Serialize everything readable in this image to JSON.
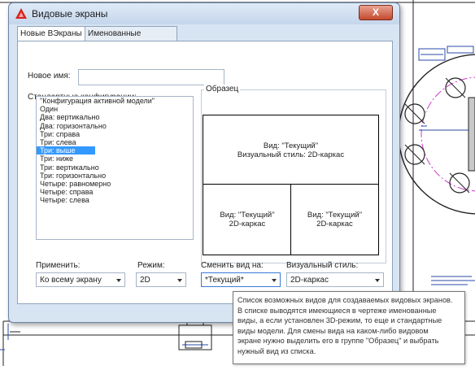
{
  "dialog": {
    "title": "Видовые экраны",
    "close_label": "X",
    "tabs": [
      {
        "label": "Новые ВЭкраны",
        "active": true
      },
      {
        "label": "Именованные ВЭкраны",
        "active": false
      }
    ],
    "new_name": {
      "label": "Новое имя:",
      "value": ""
    },
    "configs": {
      "label": "Стандартные конфигурации:",
      "items": [
        "\"Конфигурация активной модели\"",
        "Один",
        "Два: вертикально",
        "Два: горизонтально",
        "Три: справа",
        "Три: слева",
        "Три: выше",
        "Три: ниже",
        "Три: вертикально",
        "Три: горизонтально",
        "Четыре: равномерно",
        "Четыре: справа",
        "Четыре: слева"
      ],
      "selected_index": 6
    },
    "sample": {
      "label": "Образец",
      "top": {
        "line1": "Вид: \"Текущий\"",
        "line2": "Визуальный стиль: 2D-каркас"
      },
      "bottom_left": {
        "line1": "Вид: \"Текущий\"",
        "line2": "2D-каркас"
      },
      "bottom_right": {
        "line1": "Вид: \"Текущий\"",
        "line2": "2D-каркас"
      }
    },
    "apply": {
      "label": "Применить:",
      "value": "Ко всему экрану"
    },
    "mode": {
      "label": "Режим:",
      "value": "2D"
    },
    "change_view": {
      "label": "Сменить вид на:",
      "value": "*Текущий*"
    },
    "visual_style": {
      "label": "Визуальный стиль:",
      "value": "2D-каркас"
    }
  },
  "tooltip": {
    "lines": [
      "Список возможных видов для создаваемых видовых экранов.",
      "В списке выводятся имеющиеся в чертеже именованные",
      "виды, а если установлен 3D-режим, то еще и стандартные",
      "виды модели. Для смены вида на каком-либо видовом",
      "экране нужно выделить его в группе \"Образец\" и выбрать",
      "нужный вид из списка."
    ]
  },
  "colors": {
    "accent": "#3399ff",
    "dialog_bg": "#d7e4f2",
    "cad_magenta": "#c83cc8",
    "cad_blue": "#2a4aa8"
  }
}
